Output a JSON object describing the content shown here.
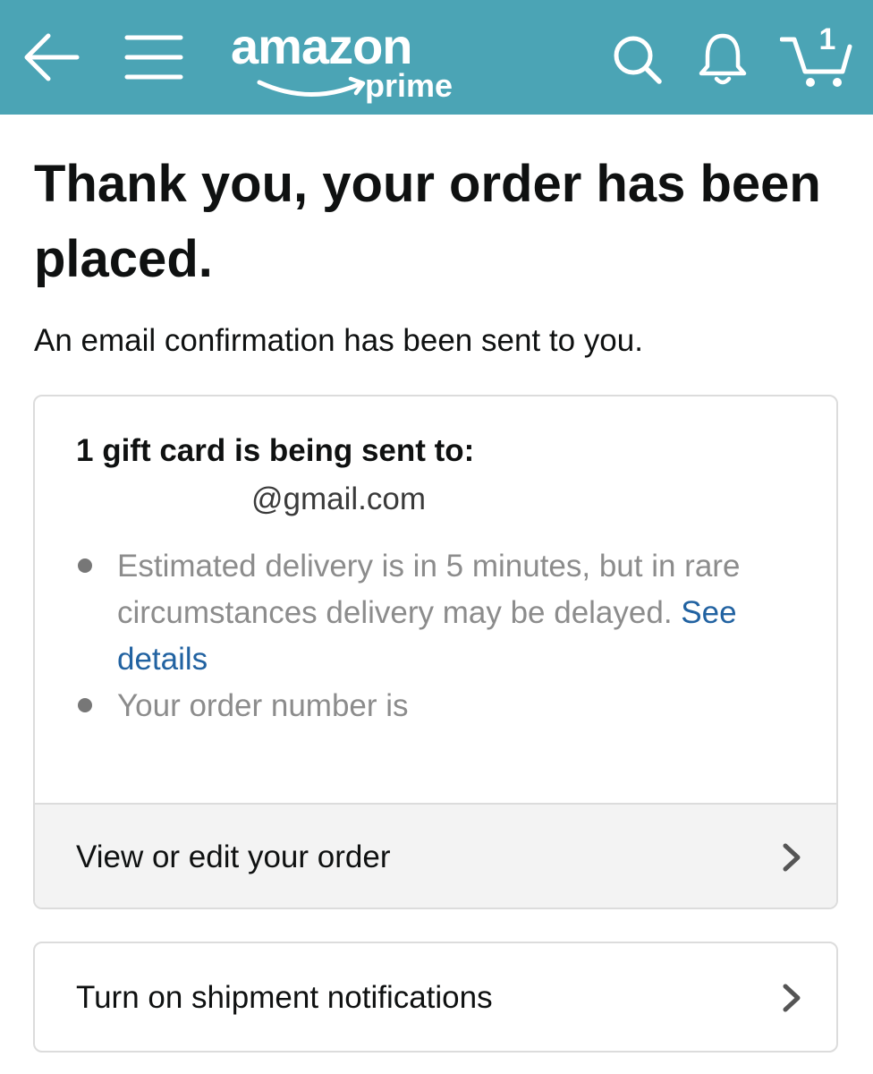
{
  "header": {
    "logo_word": "amazon",
    "logo_sub": "prime",
    "cart_count": "1",
    "icons": [
      "back-arrow-icon",
      "menu-icon",
      "search-icon",
      "bell-icon",
      "cart-icon"
    ],
    "background_color": "#4ba4b5"
  },
  "confirmation": {
    "title": "Thank you, your order has been placed.",
    "subtitle": "An email confirmation has been sent to you."
  },
  "gift_card": {
    "heading": "1 gift card is being sent to:",
    "recipient": "@gmail.com",
    "bullets": {
      "delivery_text": "Estimated delivery is in 5 minutes, but in rare circumstances delivery may be delayed. ",
      "delivery_link": "See details",
      "order_number_text": "Your order number is"
    },
    "link_color": "#2162a1"
  },
  "actions": {
    "view_edit_label": "View or edit your order",
    "notifications_label": "Turn on shipment notifications"
  }
}
